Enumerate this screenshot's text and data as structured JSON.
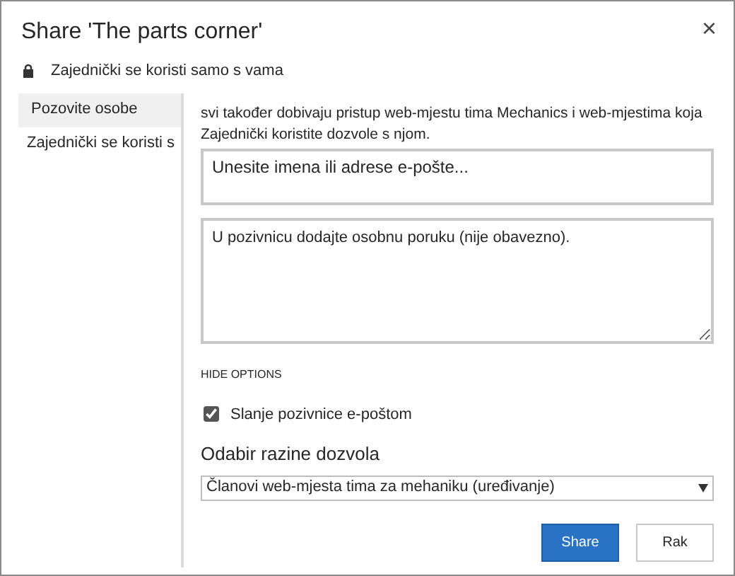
{
  "dialog": {
    "title": "Share 'The parts corner'",
    "close": "×"
  },
  "sharing_status": "Zajednički se koristi samo s vama",
  "sidebar": {
    "items": [
      {
        "label": "Pozovite osobe",
        "selected": true
      },
      {
        "label": "Zajednički se koristi s",
        "selected": false
      }
    ]
  },
  "info_text": "svi također dobivaju pristup web-mjestu tima Mechanics i web-mjestima koja Zajednički koristite dozvole s njom.",
  "names_field": {
    "placeholder": "Unesite imena ili adrese e-pošte..."
  },
  "message_field": {
    "placeholder": "U pozivnicu dodajte osobnu poruku (nije obavezno)."
  },
  "options_link": "HIDE OPTIONS",
  "email_invite": {
    "label": "Slanje pozivnice e-poštom",
    "checked": true
  },
  "permission": {
    "label": "Odabir razine dozvola",
    "value": "Članovi web-mjesta tima za mehaniku (uređivanje)"
  },
  "buttons": [
    {
      "label": "Share",
      "kind": "primary"
    },
    {
      "label": "Rak",
      "kind": "secondary"
    }
  ]
}
